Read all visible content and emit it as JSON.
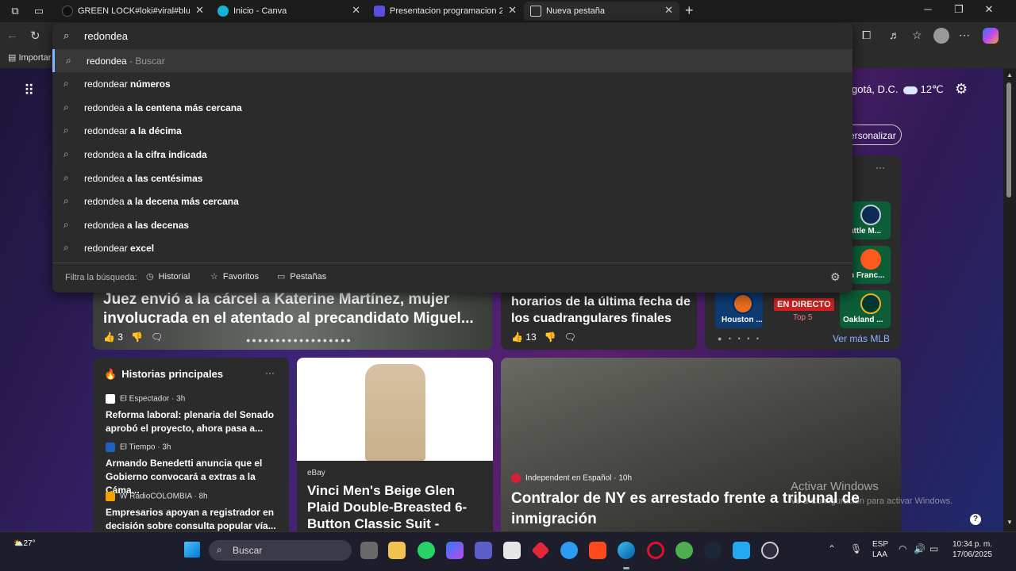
{
  "tabs": [
    {
      "title": "GREEN LOCK#loki#viral#blue#fo"
    },
    {
      "title": "Inicio - Canva"
    },
    {
      "title": "Presentacion programacion 2 - Pr"
    },
    {
      "title": "Nueva pestaña"
    }
  ],
  "bookmarks": {
    "first": "Importar"
  },
  "omnibox": {
    "query": "redondea",
    "suggestions": [
      {
        "base": "redondea",
        "bold": "",
        "hint": " - Buscar"
      },
      {
        "base": "redondear ",
        "bold": "números",
        "hint": ""
      },
      {
        "base": "redondea ",
        "bold": "a la centena más cercana",
        "hint": ""
      },
      {
        "base": "redondear ",
        "bold": "a la décima",
        "hint": ""
      },
      {
        "base": "redondea ",
        "bold": "a la cifra indicada",
        "hint": ""
      },
      {
        "base": "redondea ",
        "bold": "a las centésimas",
        "hint": ""
      },
      {
        "base": "redondea ",
        "bold": "a la decena más cercana",
        "hint": ""
      },
      {
        "base": "redondea ",
        "bold": "a las decenas",
        "hint": ""
      },
      {
        "base": "redondear ",
        "bold": "excel",
        "hint": ""
      }
    ],
    "filter_label": "Filtra la búsqueda:",
    "filters": [
      "Historial",
      "Favoritos",
      "Pestañas"
    ]
  },
  "newtab": {
    "weather_text": "gotá, D.C.",
    "temperature": "12℃",
    "personalize": "ersonalizar",
    "hero": {
      "title": "Juez envió a la cárcel a Katerine Martínez, mujer involucrada en el atentado al precandidato Miguel...",
      "likes": "3",
      "pager": "●●●●●●●●●●●●●●●●●●"
    },
    "mid": {
      "title": "horarios de la última fecha de los cuadrangulares finales",
      "likes": "13"
    },
    "mlb": {
      "teams": [
        "attle M...",
        "n Franc...",
        "Houston ...",
        "Oakland ..."
      ],
      "live": "EN DIRECTO",
      "top5": "Top 5",
      "more": "Ver más MLB",
      "pager": "● • • • •"
    },
    "stories": {
      "header": "Historias principales",
      "items": [
        {
          "source": "El Espectador · 3h",
          "headline": "Reforma laboral: plenaria del Senado aprobó el proyecto, ahora pasa a...",
          "color": "#ffffff"
        },
        {
          "source": "El Tiempo · 3h",
          "headline": "Armando Benedetti anuncia que el Gobierno convocará a extras a la Cáma...",
          "color": "#1f5fbf"
        },
        {
          "source": "W RadioCOLOMBIA · 8h",
          "headline": "Empresarios apoyan a registrador en decisión sobre consulta popular vía...",
          "color": "#f2a300"
        }
      ]
    },
    "ebay": {
      "source": "eBay",
      "title": "Vinci Men's Beige Glen Plaid Double-Breasted 6-Button Classic Suit -"
    },
    "nyc": {
      "source": "Independent en Español · 10h",
      "title": "Contralor de NY es arrestado frente a tribunal de inmigración"
    },
    "activate_title": "Activar Windows",
    "activate_sub": "Ve a Configuración para activar Windows."
  },
  "taskbar": {
    "weather": "27°",
    "search_placeholder": "Buscar",
    "lang1": "ESP",
    "lang2": "LAA",
    "time": "10:34 p. m.",
    "date": "17/06/2025"
  }
}
